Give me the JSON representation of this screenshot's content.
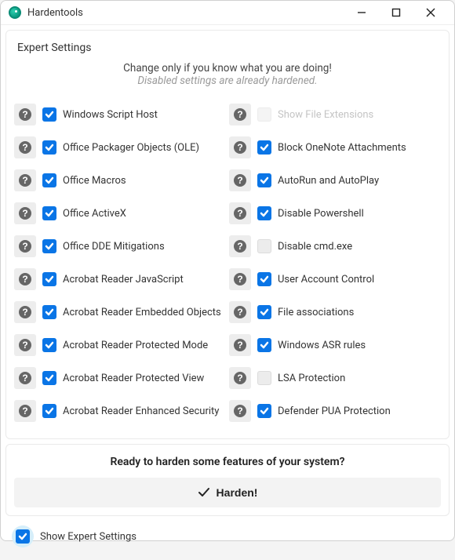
{
  "app": {
    "name": "Hardentools"
  },
  "section": {
    "title": "Expert Settings",
    "warn1": "Change only if you know what you are doing!",
    "warn2": "Disabled settings are already hardened."
  },
  "settings": {
    "left": [
      {
        "label": "Windows Script Host",
        "checked": true,
        "disabled": false
      },
      {
        "label": "Office Packager Objects (OLE)",
        "checked": true,
        "disabled": false
      },
      {
        "label": "Office Macros",
        "checked": true,
        "disabled": false
      },
      {
        "label": "Office ActiveX",
        "checked": true,
        "disabled": false
      },
      {
        "label": "Office DDE Mitigations",
        "checked": true,
        "disabled": false
      },
      {
        "label": "Acrobat Reader JavaScript",
        "checked": true,
        "disabled": false
      },
      {
        "label": "Acrobat Reader Embedded Objects",
        "checked": true,
        "disabled": false
      },
      {
        "label": "Acrobat Reader Protected Mode",
        "checked": true,
        "disabled": false
      },
      {
        "label": "Acrobat Reader Protected View",
        "checked": true,
        "disabled": false
      },
      {
        "label": "Acrobat Reader Enhanced Security",
        "checked": true,
        "disabled": false
      }
    ],
    "right": [
      {
        "label": "Show File Extensions",
        "checked": false,
        "disabled": true
      },
      {
        "label": "Block OneNote Attachments",
        "checked": true,
        "disabled": false
      },
      {
        "label": "AutoRun and AutoPlay",
        "checked": true,
        "disabled": false
      },
      {
        "label": "Disable Powershell",
        "checked": true,
        "disabled": false
      },
      {
        "label": "Disable cmd.exe",
        "checked": false,
        "disabled": false
      },
      {
        "label": "User Account Control",
        "checked": true,
        "disabled": false
      },
      {
        "label": "File associations",
        "checked": true,
        "disabled": false
      },
      {
        "label": "Windows ASR rules",
        "checked": true,
        "disabled": false
      },
      {
        "label": "LSA Protection",
        "checked": false,
        "disabled": false
      },
      {
        "label": "Defender PUA Protection",
        "checked": true,
        "disabled": false
      }
    ]
  },
  "ready": {
    "text": "Ready to harden some features of your system?",
    "button": "Harden!"
  },
  "footer": {
    "show_expert": {
      "label": "Show Expert Settings",
      "checked": true
    }
  }
}
